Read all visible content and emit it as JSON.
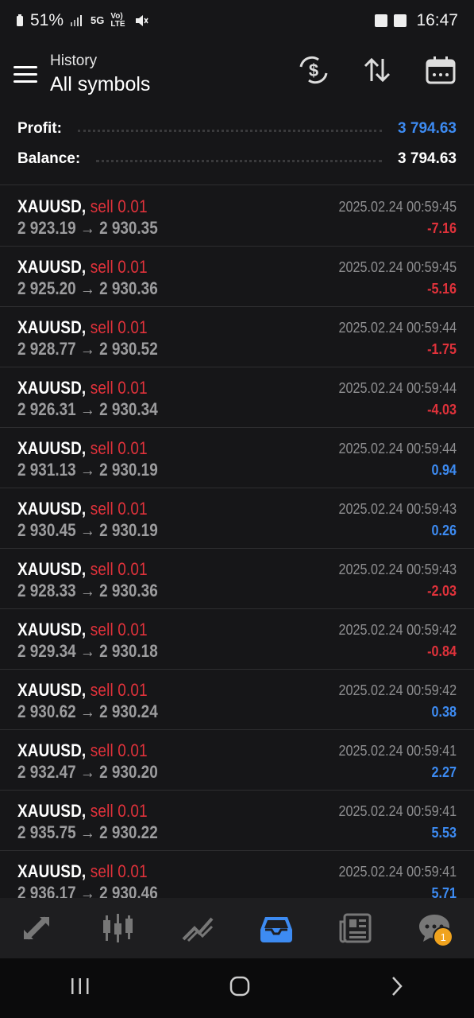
{
  "status": {
    "battery": "51%",
    "time": "16:47",
    "net_5g": "5G",
    "volte": "Vo) LTE"
  },
  "header": {
    "subtitle": "History",
    "title": "All symbols"
  },
  "summary": {
    "profit_label": "Profit:",
    "profit_value": "3 794.63",
    "balance_label": "Balance:",
    "balance_value": "3 794.63"
  },
  "colors": {
    "accent": "#3d8bf2",
    "negative": "#e0323b",
    "badge": "#f0a31e"
  },
  "trades": [
    {
      "symbol": "XAUUSD,",
      "side": " sell 0.01",
      "prices": "2 923.19 → 2 930.35",
      "time": "2025.02.24 00:59:45",
      "pl": "-7.16",
      "sign": "neg"
    },
    {
      "symbol": "XAUUSD,",
      "side": " sell 0.01",
      "prices": "2 925.20 → 2 930.36",
      "time": "2025.02.24 00:59:45",
      "pl": "-5.16",
      "sign": "neg"
    },
    {
      "symbol": "XAUUSD,",
      "side": " sell 0.01",
      "prices": "2 928.77 → 2 930.52",
      "time": "2025.02.24 00:59:44",
      "pl": "-1.75",
      "sign": "neg"
    },
    {
      "symbol": "XAUUSD,",
      "side": " sell 0.01",
      "prices": "2 926.31 → 2 930.34",
      "time": "2025.02.24 00:59:44",
      "pl": "-4.03",
      "sign": "neg"
    },
    {
      "symbol": "XAUUSD,",
      "side": " sell 0.01",
      "prices": "2 931.13 → 2 930.19",
      "time": "2025.02.24 00:59:44",
      "pl": "0.94",
      "sign": "pos"
    },
    {
      "symbol": "XAUUSD,",
      "side": " sell 0.01",
      "prices": "2 930.45 → 2 930.19",
      "time": "2025.02.24 00:59:43",
      "pl": "0.26",
      "sign": "pos"
    },
    {
      "symbol": "XAUUSD,",
      "side": " sell 0.01",
      "prices": "2 928.33 → 2 930.36",
      "time": "2025.02.24 00:59:43",
      "pl": "-2.03",
      "sign": "neg"
    },
    {
      "symbol": "XAUUSD,",
      "side": " sell 0.01",
      "prices": "2 929.34 → 2 930.18",
      "time": "2025.02.24 00:59:42",
      "pl": "-0.84",
      "sign": "neg"
    },
    {
      "symbol": "XAUUSD,",
      "side": " sell 0.01",
      "prices": "2 930.62 → 2 930.24",
      "time": "2025.02.24 00:59:42",
      "pl": "0.38",
      "sign": "pos"
    },
    {
      "symbol": "XAUUSD,",
      "side": " sell 0.01",
      "prices": "2 932.47 → 2 930.20",
      "time": "2025.02.24 00:59:41",
      "pl": "2.27",
      "sign": "pos"
    },
    {
      "symbol": "XAUUSD,",
      "side": " sell 0.01",
      "prices": "2 935.75 → 2 930.22",
      "time": "2025.02.24 00:59:41",
      "pl": "5.53",
      "sign": "pos"
    },
    {
      "symbol": "XAUUSD,",
      "side": " sell 0.01",
      "prices": "2 936.17 → 2 930.46",
      "time": "2025.02.24 00:59:41",
      "pl": "5.71",
      "sign": "pos"
    }
  ],
  "nav": {
    "items": [
      "trade-arrows-icon",
      "candlestick-icon",
      "chart-line-icon",
      "history-inbox-icon",
      "news-icon",
      "chat-icon"
    ],
    "active": "history-inbox-icon",
    "chat_badge": "1"
  }
}
